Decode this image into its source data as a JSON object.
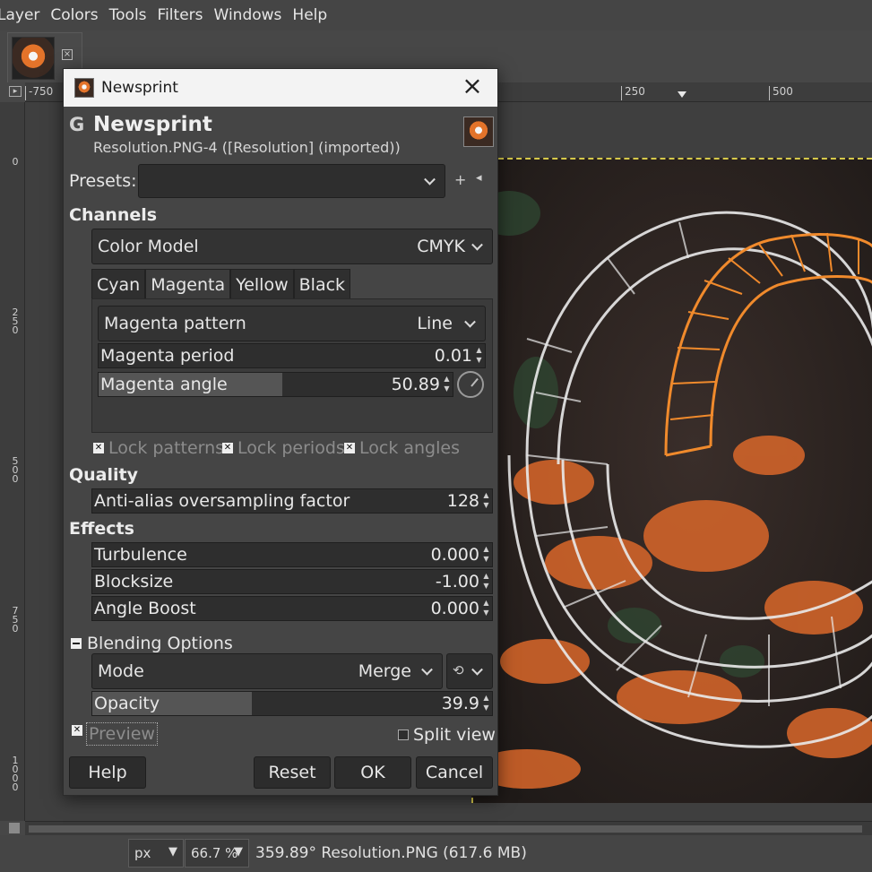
{
  "menubar": {
    "items": [
      "Layer",
      "Colors",
      "Tools",
      "Filters",
      "Windows",
      "Help"
    ]
  },
  "rulers": {
    "h_left_label": "-750",
    "h_ticks": [
      "250",
      "500"
    ],
    "v_ticks": [
      "0",
      "250",
      "500",
      "750",
      "1000"
    ]
  },
  "statusbar": {
    "unit": "px",
    "zoom": "66.7 %",
    "info": "359.89° Resolution.PNG (617.6 MB)"
  },
  "dialog": {
    "window_title": "Newsprint",
    "header_title": "Newsprint",
    "header_subtitle": "Resolution.PNG-4 ([Resolution] (imported))",
    "presets_label": "Presets:",
    "presets_value": "",
    "channels": {
      "section": "Channels",
      "color_model_label": "Color Model",
      "color_model_value": "CMYK",
      "tabs": [
        "Cyan",
        "Magenta",
        "Yellow",
        "Black"
      ],
      "active_tab": "Magenta",
      "pattern_label": "Magenta pattern",
      "pattern_value": "Line",
      "period_label": "Magenta period",
      "period_value": "0.01",
      "angle_label": "Magenta angle",
      "angle_value": "50.89",
      "angle_fill_percent": 52
    },
    "locks": {
      "patterns": "Lock patterns",
      "periods": "Lock periods",
      "angles": "Lock angles"
    },
    "quality": {
      "section": "Quality",
      "aa_label": "Anti-alias oversampling factor",
      "aa_value": "128"
    },
    "effects": {
      "section": "Effects",
      "turbulence_label": "Turbulence",
      "turbulence_value": "0.000",
      "blocksize_label": "Blocksize",
      "blocksize_value": "-1.00",
      "angleboost_label": "Angle Boost",
      "angleboost_value": "0.000"
    },
    "blending": {
      "expander": "Blending Options",
      "mode_label": "Mode",
      "mode_value": "Merge",
      "opacity_label": "Opacity",
      "opacity_value": "39.9",
      "opacity_fill_percent": 39.9
    },
    "preview_label": "Preview",
    "split_view_label": "Split view",
    "buttons": {
      "help": "Help",
      "reset": "Reset",
      "ok": "OK",
      "cancel": "Cancel"
    }
  },
  "colors": {
    "accent_orange": "#e3732a",
    "dialog_bg": "#454545",
    "titlebar_bg": "#f3f3f3"
  }
}
